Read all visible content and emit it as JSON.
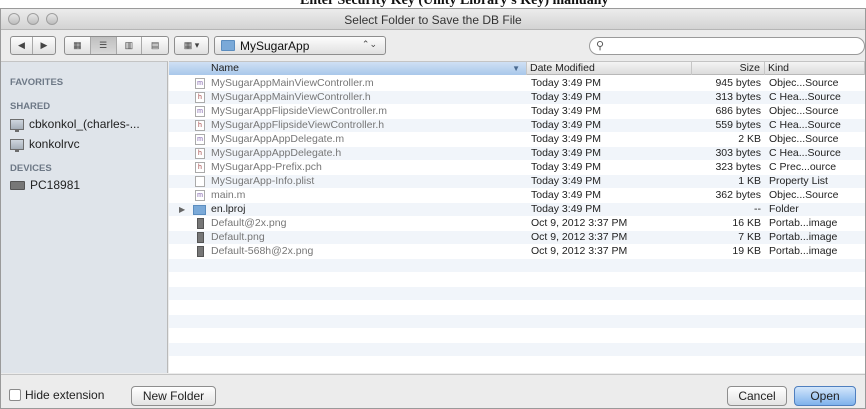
{
  "window": {
    "title": "Select Folder to Save the DB File"
  },
  "background_text": "Enter Security Key (Unity Library's Key) manually",
  "toolbar": {
    "nav_back": "◀",
    "nav_forward": "▶",
    "view_icons": "▦",
    "view_list": "☰",
    "view_columns": "▥",
    "view_coverflow": "▤",
    "arrange": "▦ ▾",
    "location": "MySugarApp",
    "location_caret": "⌃⌄",
    "search_icon": "⚲",
    "search_value": ""
  },
  "sidebar": {
    "favorites_header": "FAVORITES",
    "shared_header": "SHARED",
    "shared_items": [
      {
        "label": "cbkonkol_(charles-..."
      },
      {
        "label": "konkolrvc"
      }
    ],
    "devices_header": "DEVICES",
    "device_items": [
      {
        "label": "PC18981"
      }
    ]
  },
  "list": {
    "columns": {
      "name": "Name",
      "date": "Date Modified",
      "size": "Size",
      "kind": "Kind"
    },
    "sort_indicator": "▼",
    "rows": [
      {
        "icon": "m",
        "name": "MySugarAppMainViewController.m",
        "date": "Today 3:49 PM",
        "size": "945 bytes",
        "kind": "Objec...Source"
      },
      {
        "icon": "h",
        "name": "MySugarAppMainViewController.h",
        "date": "Today 3:49 PM",
        "size": "313 bytes",
        "kind": "C Hea...Source"
      },
      {
        "icon": "m",
        "name": "MySugarAppFlipsideViewController.m",
        "date": "Today 3:49 PM",
        "size": "686 bytes",
        "kind": "Objec...Source"
      },
      {
        "icon": "h",
        "name": "MySugarAppFlipsideViewController.h",
        "date": "Today 3:49 PM",
        "size": "559 bytes",
        "kind": "C Hea...Source"
      },
      {
        "icon": "m",
        "name": "MySugarAppAppDelegate.m",
        "date": "Today 3:49 PM",
        "size": "2 KB",
        "kind": "Objec...Source"
      },
      {
        "icon": "h",
        "name": "MySugarAppAppDelegate.h",
        "date": "Today 3:49 PM",
        "size": "303 bytes",
        "kind": "C Hea...Source"
      },
      {
        "icon": "h",
        "name": "MySugarApp-Prefix.pch",
        "date": "Today 3:49 PM",
        "size": "323 bytes",
        "kind": "C Prec...ource"
      },
      {
        "icon": "",
        "name": "MySugarApp-Info.plist",
        "date": "Today 3:49 PM",
        "size": "1 KB",
        "kind": "Property List"
      },
      {
        "icon": "m",
        "name": "main.m",
        "date": "Today 3:49 PM",
        "size": "362 bytes",
        "kind": "Objec...Source"
      },
      {
        "icon": "folder",
        "name": "en.lproj",
        "date": "Today 3:49 PM",
        "size": "--",
        "kind": "Folder"
      },
      {
        "icon": "png",
        "name": "Default@2x.png",
        "date": "Oct 9, 2012 3:37 PM",
        "size": "16 KB",
        "kind": "Portab...image"
      },
      {
        "icon": "png",
        "name": "Default.png",
        "date": "Oct 9, 2012 3:37 PM",
        "size": "7 KB",
        "kind": "Portab...image"
      },
      {
        "icon": "png",
        "name": "Default-568h@2x.png",
        "date": "Oct 9, 2012 3:37 PM",
        "size": "19 KB",
        "kind": "Portab...image"
      }
    ]
  },
  "bottom": {
    "hide_extension_label": "Hide extension",
    "hide_extension_checked": false,
    "new_folder": "New Folder",
    "cancel": "Cancel",
    "open": "Open"
  }
}
